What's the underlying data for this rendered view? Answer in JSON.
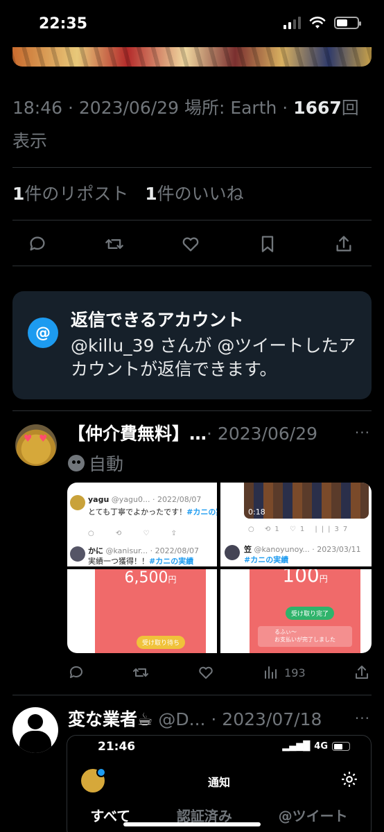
{
  "status_bar": {
    "time": "22:35"
  },
  "tweet_detail": {
    "meta": {
      "time": "18:46",
      "date": "2023/06/29",
      "location_prefix": "場所: ",
      "location": "Earth",
      "views_count": "1667",
      "views_label": "回表示",
      "sep": " · "
    },
    "counts": {
      "reposts_num": "1",
      "reposts_label": "件のリポスト",
      "likes_num": "1",
      "likes_label": "件のいいね"
    },
    "reply_restriction": {
      "icon_glyph": "@",
      "title": "返信できるアカウント",
      "description": "@killu_39 さんが @ツイートしたアカウントが返信できます。"
    }
  },
  "replies": [
    {
      "display_name": "【仲介費無料】…",
      "date": "· 2023/06/29",
      "more": "···",
      "auto_label": "自動",
      "views": "193",
      "media": {
        "tl": {
          "row1_name": "yagu",
          "row1_meta": " @yagu0... · 2022/08/07",
          "row1_text": "とても丁寧でよかったです！",
          "row1_hash": "#カニの実績",
          "row2_name": "かに",
          "row2_meta": " @kanisur... · 2022/08/07",
          "row2_text": "実績一つ獲得！！",
          "row2_hash": "#カニの実績"
        },
        "tr": {
          "video_time": "0:18",
          "row_name": "笠",
          "row_meta": " @kanoyunoy... · 2023/03/11",
          "row_hash": "#カニの実績",
          "stat_1": "1",
          "stat_2": "1",
          "stat_3": "37"
        },
        "bl": {
          "amount": "6,500",
          "currency": "円",
          "pill": "受け取り待ち"
        },
        "br": {
          "amount": "100",
          "currency": "円",
          "pill": "受け取り完了",
          "note_name": "るふぃ〜",
          "note_text": "お支払いが完了しました"
        }
      }
    },
    {
      "display_name": "変な業者☕",
      "handle": " @D...",
      "date": " · 2023/07/18",
      "more": "···",
      "screenshot": {
        "time": "21:46",
        "network": "4G",
        "title": "通知",
        "tabs": [
          "すべて",
          "認証済み",
          "@ツイート"
        ]
      }
    }
  ],
  "colors": {
    "accent": "#1d9bf0",
    "muted": "#71767b",
    "reply_box_bg": "#16202a",
    "divider": "#2f3336"
  }
}
